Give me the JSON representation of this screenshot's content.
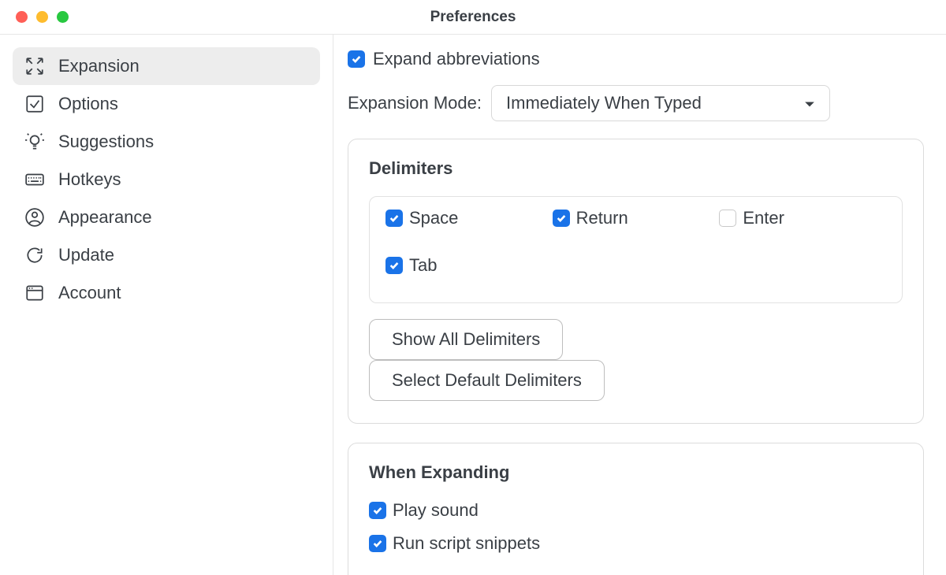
{
  "window": {
    "title": "Preferences"
  },
  "sidebar": {
    "items": [
      {
        "label": "Expansion"
      },
      {
        "label": "Options"
      },
      {
        "label": "Suggestions"
      },
      {
        "label": "Hotkeys"
      },
      {
        "label": "Appearance"
      },
      {
        "label": "Update"
      },
      {
        "label": "Account"
      }
    ]
  },
  "main": {
    "expand_abbrev_label": "Expand abbreviations",
    "expansion_mode_label": "Expansion Mode:",
    "expansion_mode_value": "Immediately When Typed",
    "delimiters_title": "Delimiters",
    "delimiters": {
      "space": "Space",
      "return": "Return",
      "enter": "Enter",
      "tab": "Tab"
    },
    "show_all_btn": "Show All Delimiters",
    "select_default_btn": "Select Default Delimiters",
    "when_expanding_title": "When Expanding",
    "play_sound_label": "Play sound",
    "run_script_label": "Run script snippets"
  }
}
